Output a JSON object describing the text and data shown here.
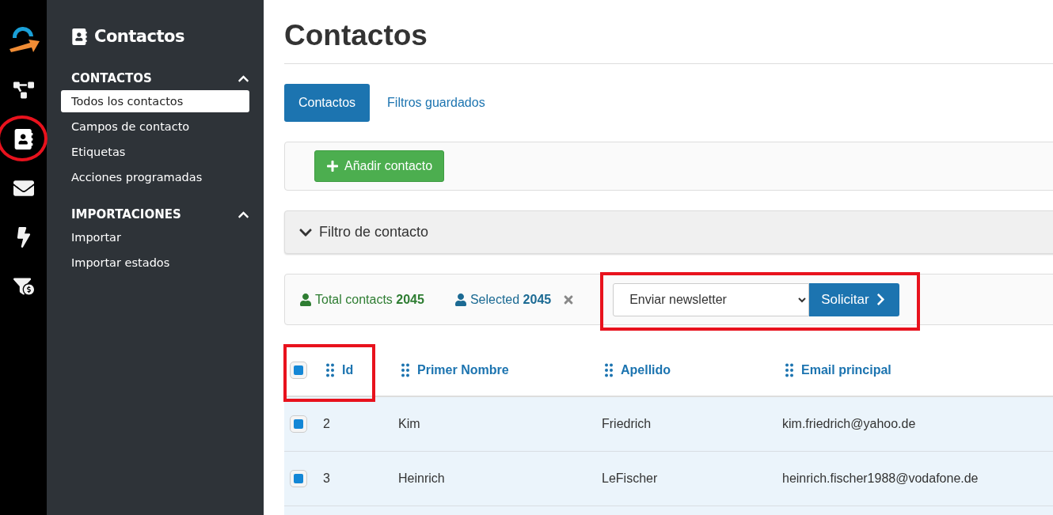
{
  "rail": {
    "items": [
      {
        "kind": "diagram",
        "selected": false,
        "highlighted": false
      },
      {
        "kind": "contacts",
        "selected": true,
        "highlighted": true
      },
      {
        "kind": "mail",
        "selected": false,
        "highlighted": false
      },
      {
        "kind": "bolt",
        "selected": false,
        "highlighted": false
      },
      {
        "kind": "funnel",
        "selected": false,
        "highlighted": false
      }
    ]
  },
  "sidebar": {
    "title": "Contactos",
    "sections": [
      {
        "label": "CONTACTOS",
        "expanded": true,
        "items": [
          {
            "label": "Todos los contactos",
            "selected": true
          },
          {
            "label": "Campos de contacto",
            "selected": false
          },
          {
            "label": "Etiquetas",
            "selected": false
          },
          {
            "label": "Acciones programadas",
            "selected": false
          }
        ]
      },
      {
        "label": "IMPORTACIONES",
        "expanded": true,
        "items": [
          {
            "label": "Importar",
            "selected": false
          },
          {
            "label": "Importar estados",
            "selected": false
          }
        ]
      }
    ]
  },
  "page": {
    "title": "Contactos"
  },
  "tabs": [
    {
      "label": "Contactos",
      "selected": true
    },
    {
      "label": "Filtros guardados",
      "selected": false
    }
  ],
  "toolbar": {
    "add_button": "Añadir contacto"
  },
  "filter": {
    "label": "Filtro de contacto",
    "expanded": false
  },
  "stats": {
    "total_label": "Total contacts",
    "total": "2045",
    "selected_label": "Selected",
    "selected": "2045"
  },
  "action": {
    "value": "Enviar newsletter",
    "button": "Solicitar",
    "highlighted": true
  },
  "table": {
    "all_checked": true,
    "id_highlighted": true,
    "columns": [
      "Id",
      "Primer Nombre",
      "Apellido",
      "Email principal"
    ],
    "rows": [
      {
        "checked": true,
        "cells": [
          "2",
          "Kim",
          "Friedrich",
          "kim.friedrich@yahoo.de"
        ]
      },
      {
        "checked": true,
        "cells": [
          "3",
          "Heinrich",
          "LeFischer",
          "heinrich.fischer1988@vodafone.de"
        ]
      },
      {
        "cells": []
      }
    ]
  }
}
